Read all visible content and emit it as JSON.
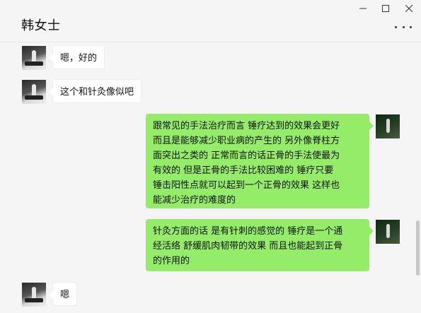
{
  "window": {
    "title": "韩女士",
    "controls": [
      "minimize-icon",
      "maximize-icon",
      "close-icon"
    ],
    "more_icon": "more-dots-icon"
  },
  "messages": [
    {
      "side": "left",
      "text": "嗯，好的"
    },
    {
      "side": "left",
      "text": "这个和针灸像似吧"
    },
    {
      "side": "right",
      "text": "跟常见的手法治疗而言  锤疗达到的效果会更好\n而且是能够减少职业病的产生的  另外像脊柱方\n面突出之类的  正常而言的话正骨的手法使最为\n有效的    但是正骨的手法比较困难的  锤疗只要\n锤击阳性点就可以起到一个正骨的效果 这样也\n能减少治疗的难度的"
    },
    {
      "side": "right",
      "text": "针灸方面的话  是有针刺的感觉的  锤疗是一个通\n经活络  舒缓肌肉韧带的效果 而且也能起到正骨\n的作用的"
    },
    {
      "side": "left",
      "text": "嗯"
    }
  ],
  "colors": {
    "background": "#f5f5f5",
    "bubble_self": "#95ec69",
    "bubble_other": "#ffffff"
  }
}
